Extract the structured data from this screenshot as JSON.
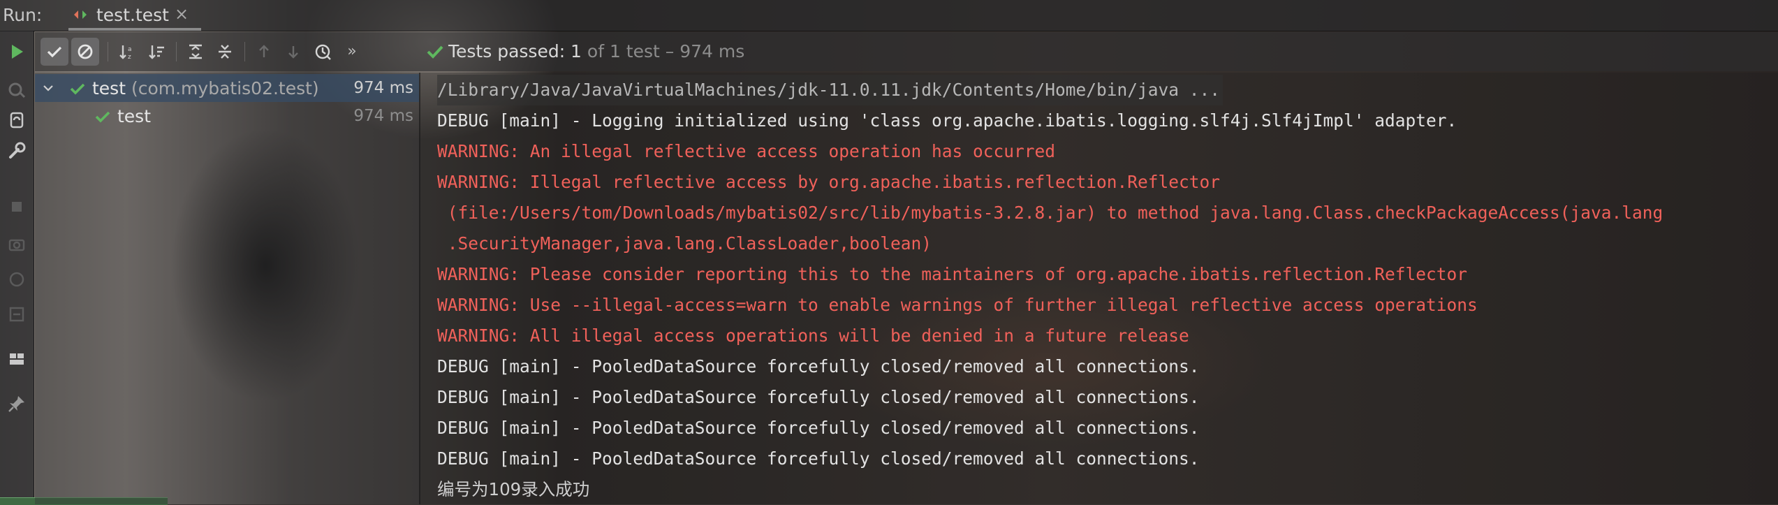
{
  "run_bar": {
    "label": "Run:",
    "tab_label": "test.test",
    "close": "×"
  },
  "toolbar": {
    "buttons": [
      {
        "icon": "rerun-icon"
      },
      {
        "icon": "show-passed-icon",
        "active": true
      },
      {
        "icon": "show-ignored-icon",
        "active": true
      },
      {
        "icon": "sort-alphabetically-icon"
      },
      {
        "icon": "sort-by-duration-icon"
      },
      {
        "icon": "expand-all-icon"
      },
      {
        "icon": "collapse-all-icon"
      },
      {
        "icon": "previous-failed-test-icon"
      },
      {
        "icon": "next-failed-test-icon"
      },
      {
        "icon": "test-history-icon"
      },
      {
        "icon": "more-icon"
      }
    ],
    "more_label": "»",
    "status_prefix": "Tests passed: 1",
    "status_suffix": " of 1 test – 974 ms"
  },
  "side_tools": [
    "rerun-icon",
    "rerun-failed-icon",
    "toggle-auto-test-icon",
    "settings-wrench-icon",
    "stop-icon",
    "screenshot-icon",
    "restore-layout-icon",
    "export-icon",
    "layout-icon",
    "pin-icon"
  ],
  "tree": {
    "root": {
      "name": "test",
      "package": " (com.mybatis02.test)",
      "time": "974 ms"
    },
    "child": {
      "name": "test",
      "time": "974 ms"
    }
  },
  "console": {
    "lines": [
      {
        "type": "cmd",
        "text": "/Library/Java/JavaVirtualMachines/jdk-11.0.11.jdk/Contents/Home/bin/java ..."
      },
      {
        "type": "out",
        "text": "DEBUG [main] - Logging initialized using 'class org.apache.ibatis.logging.slf4j.Slf4jImpl' adapter."
      },
      {
        "type": "warn",
        "text": "WARNING: An illegal reflective access operation has occurred"
      },
      {
        "type": "warn",
        "text": "WARNING: Illegal reflective access by org.apache.ibatis.reflection.Reflector"
      },
      {
        "type": "warn",
        "text": " (file:/Users/tom/Downloads/mybatis02/src/lib/mybatis-3.2.8.jar) to method java.lang.Class.checkPackageAccess(java.lang"
      },
      {
        "type": "warn",
        "text": " .SecurityManager,java.lang.ClassLoader,boolean)"
      },
      {
        "type": "warn",
        "text": "WARNING: Please consider reporting this to the maintainers of org.apache.ibatis.reflection.Reflector"
      },
      {
        "type": "warn",
        "text": "WARNING: Use --illegal-access=warn to enable warnings of further illegal reflective access operations"
      },
      {
        "type": "warn",
        "text": "WARNING: All illegal access operations will be denied in a future release"
      },
      {
        "type": "out",
        "text": "DEBUG [main] - PooledDataSource forcefully closed/removed all connections."
      },
      {
        "type": "out",
        "text": "DEBUG [main] - PooledDataSource forcefully closed/removed all connections."
      },
      {
        "type": "out",
        "text": "DEBUG [main] - PooledDataSource forcefully closed/removed all connections."
      },
      {
        "type": "out",
        "text": "DEBUG [main] - PooledDataSource forcefully closed/removed all connections."
      },
      {
        "type": "cn",
        "text": "编号为109录入成功"
      }
    ]
  },
  "colors": {
    "pass_green": "#5fb85f",
    "warning_red": "#f0615a",
    "selection_blue": "#374b64"
  }
}
